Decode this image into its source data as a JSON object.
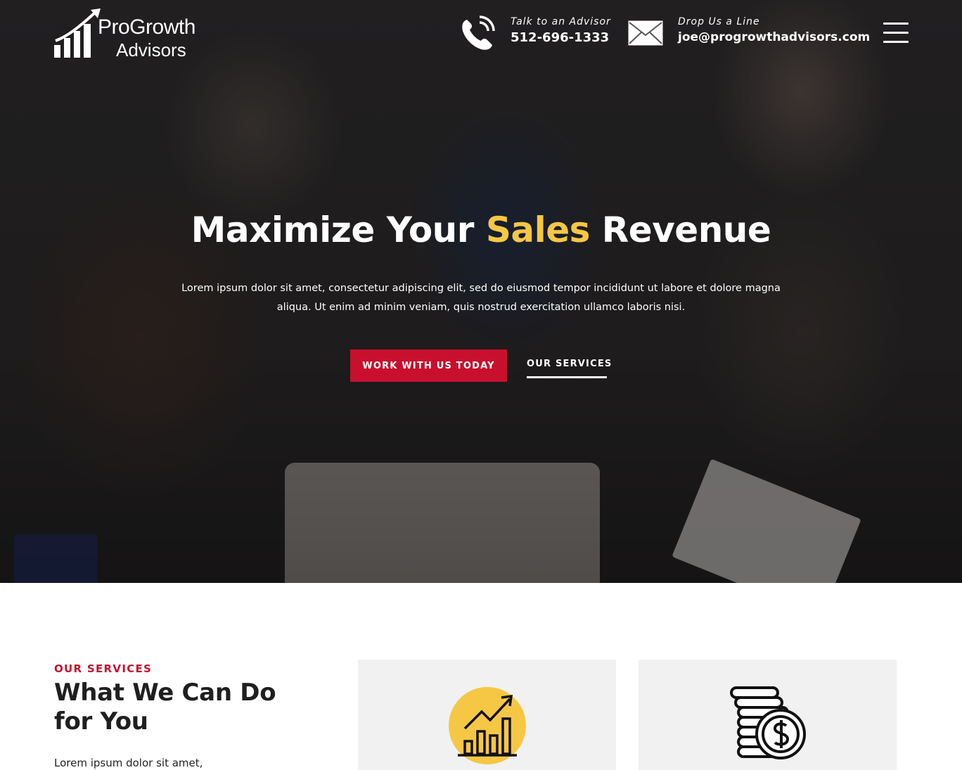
{
  "brand": {
    "name_line1": "ProGrowth",
    "name_line2": "Advisors"
  },
  "header": {
    "phone": {
      "label": "Talk to an Advisor",
      "value": "512-696-1333",
      "icon": "phone-icon"
    },
    "email": {
      "label": "Drop Us a Line",
      "value": "joe@progrowthadvisors.com",
      "icon": "envelope-icon"
    },
    "menu_icon": "hamburger-menu-icon"
  },
  "hero": {
    "title_part1": "Maximize Your ",
    "title_accent": "Sales",
    "title_part2": " Revenue",
    "subtitle": "Lorem ipsum dolor sit amet, consectetur adipiscing elit, sed do eiusmod tempor incididunt ut labore et dolore magna aliqua. Ut enim ad minim veniam, quis nostrud exercitation ullamco laboris nisi.",
    "primary_cta": "WORK WITH US TODAY",
    "secondary_cta": "OUR SERVICES"
  },
  "services": {
    "eyebrow": "OUR SERVICES",
    "heading": "What We Can Do for You",
    "text": "Lorem ipsum dolor sit amet,",
    "cards": [
      {
        "icon": "growth-chart-icon"
      },
      {
        "icon": "coins-stack-icon"
      }
    ]
  },
  "colors": {
    "accent_red": "#c8102e",
    "accent_yellow": "#f6c744",
    "card_bg": "#f1f1f1"
  }
}
